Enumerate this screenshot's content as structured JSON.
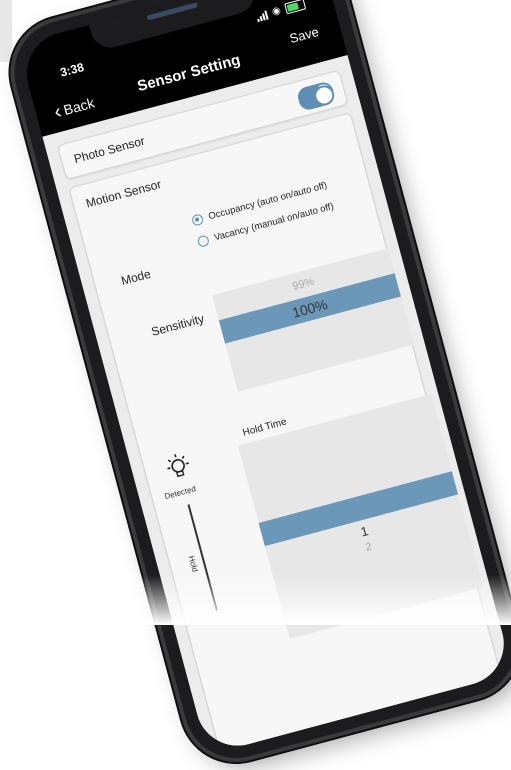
{
  "status_bar": {
    "time": "3:38"
  },
  "nav": {
    "back_label": "Back",
    "title": "Sensor Setting",
    "save_label": "Save"
  },
  "photo_sensor": {
    "label": "Photo Sensor",
    "enabled": true
  },
  "motion_sensor": {
    "label": "Motion Sensor",
    "enabled": true,
    "mode": {
      "label": "Mode",
      "options": [
        {
          "label": "Occupancy (auto on/auto off)",
          "selected": true
        },
        {
          "label": "Vacancy (manual on/auto off)",
          "selected": false
        }
      ]
    },
    "sensitivity": {
      "label": "Sensitivity",
      "previous": "99%",
      "value": "100%"
    },
    "hold_time": {
      "title": "Hold Time",
      "detected_label": "Detected",
      "hold_label": "Hold",
      "value": "1",
      "next": "2"
    }
  },
  "colors": {
    "accent": "#5e8fb3",
    "picker_bar": "#6b97b8",
    "background": "#ececec"
  },
  "icons": {
    "back": "chevron-left-icon",
    "bulb": "lightbulb-icon",
    "wifi": "wifi-icon",
    "battery": "battery-icon"
  }
}
